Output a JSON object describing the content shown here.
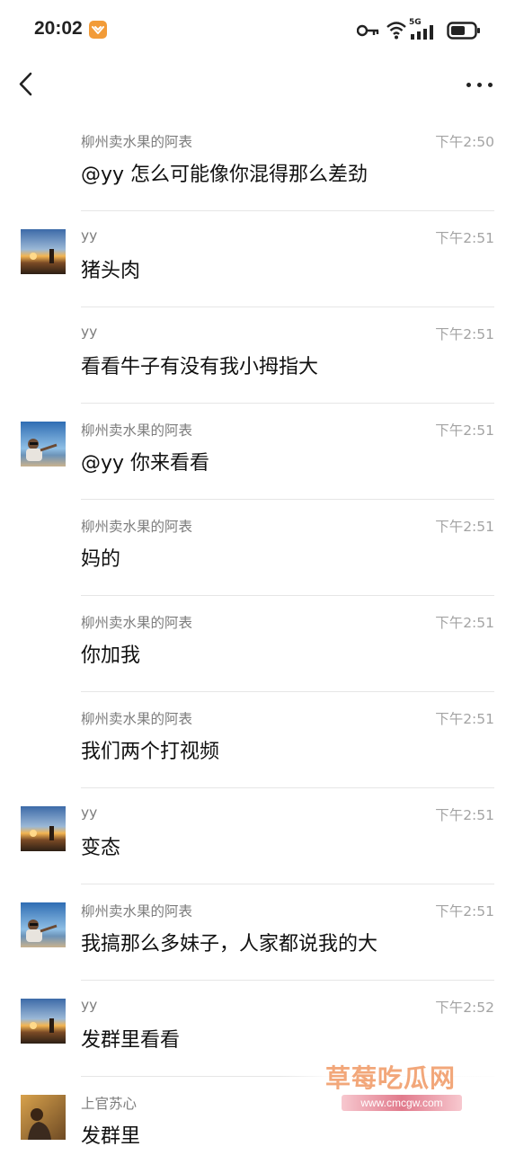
{
  "status_bar": {
    "time": "20:02",
    "network": "5G",
    "icons": [
      "key-icon",
      "wifi-icon",
      "signal-icon",
      "battery-icon"
    ]
  },
  "nav": {
    "back_icon": "chevron-left-icon",
    "more_icon": "more-horizontal-icon"
  },
  "messages": [
    {
      "sender": "柳州卖水果的阿表",
      "time": "下午2:50",
      "text": "@yy 怎么可能像你混得那么差劲",
      "avatar": ""
    },
    {
      "sender": "yy",
      "time": "下午2:51",
      "text": "猪头肉",
      "avatar": "sunset"
    },
    {
      "sender": "yy",
      "time": "下午2:51",
      "text": "看看牛子有没有我小拇指大",
      "avatar": ""
    },
    {
      "sender": "柳州卖水果的阿表",
      "time": "下午2:51",
      "text": "@yy 你来看看",
      "avatar": "person"
    },
    {
      "sender": "柳州卖水果的阿表",
      "time": "下午2:51",
      "text": "妈的",
      "avatar": ""
    },
    {
      "sender": "柳州卖水果的阿表",
      "time": "下午2:51",
      "text": "你加我",
      "avatar": ""
    },
    {
      "sender": "柳州卖水果的阿表",
      "time": "下午2:51",
      "text": "我们两个打视频",
      "avatar": ""
    },
    {
      "sender": "yy",
      "time": "下午2:51",
      "text": "变态",
      "avatar": "sunset"
    },
    {
      "sender": "柳州卖水果的阿表",
      "time": "下午2:51",
      "text": "我搞那么多妹子，人家都说我的大",
      "avatar": "person"
    },
    {
      "sender": "yy",
      "time": "下午2:52",
      "text": "发群里看看",
      "avatar": "sunset"
    },
    {
      "sender": "上官苏心",
      "time": "",
      "text": "发群里",
      "avatar": "girl"
    }
  ],
  "watermark": {
    "title": "草莓吃瓜网",
    "url": "www.cmcgw.com"
  }
}
